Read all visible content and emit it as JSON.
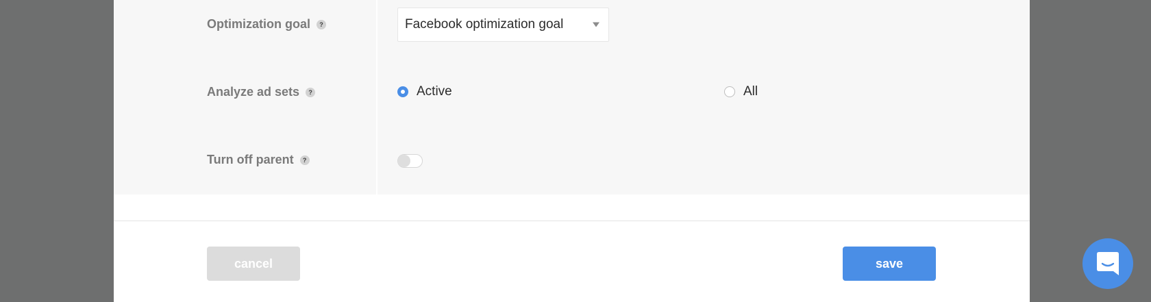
{
  "form": {
    "rows": [
      {
        "label": "Optimization goal",
        "help": "?"
      },
      {
        "label": "Analyze ad sets",
        "help": "?"
      },
      {
        "label": "Turn off parent",
        "help": "?"
      }
    ],
    "optimization_goal": {
      "selected": "Facebook optimization goal"
    },
    "analyze_ad_sets": {
      "options": [
        {
          "label": "Active",
          "checked": true
        },
        {
          "label": "All",
          "checked": false
        }
      ]
    },
    "turn_off_parent": {
      "enabled": false
    }
  },
  "footer": {
    "cancel_label": "cancel",
    "save_label": "save"
  },
  "icons": {
    "help": "question-mark",
    "select_arrow": "triangle-down",
    "chat": "chat-bubble"
  },
  "colors": {
    "accent": "#4a8ee6",
    "overlay": "#6e6f6f",
    "form_bg": "#f7f7f7",
    "cancel_bg": "#dcdcdc"
  }
}
